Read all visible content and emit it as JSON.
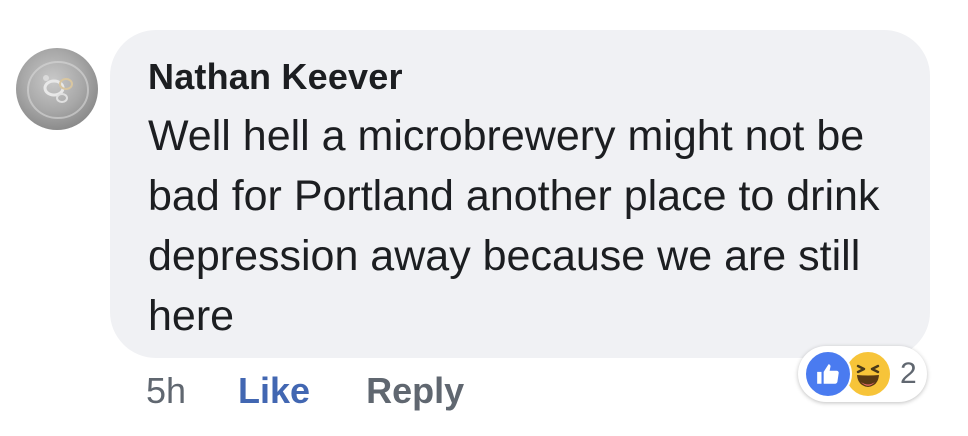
{
  "comment": {
    "author": "Nathan Keever",
    "text": "Well hell a microbrewery might not be bad for Portland another place to drink depression away because we are still here",
    "avatar_icon": "profile-avatar"
  },
  "actions": {
    "time": "5h",
    "like_label": "Like",
    "reply_label": "Reply"
  },
  "reactions": {
    "icons": [
      "like-icon",
      "haha-icon"
    ],
    "count": "2",
    "colors": {
      "like": "#4a7bf0",
      "haha": "#f7c439"
    }
  }
}
